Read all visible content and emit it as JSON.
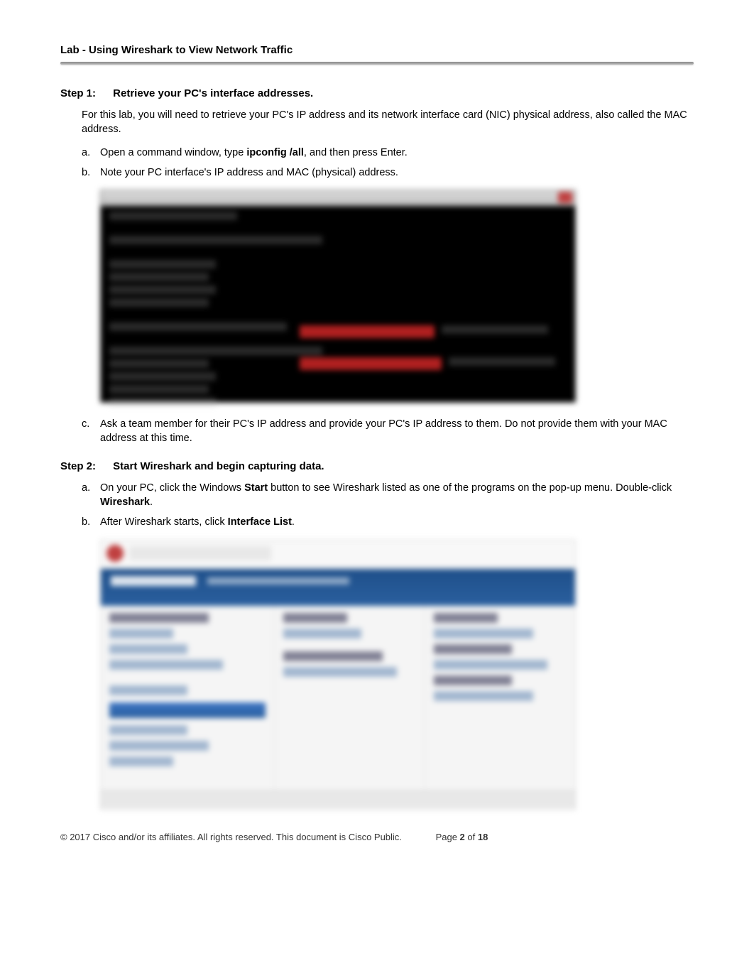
{
  "header": {
    "title": "Lab - Using Wireshark to View Network Traffic"
  },
  "step1": {
    "heading_label": "Step 1:",
    "heading_text": "Retrieve your PC's interface addresses.",
    "intro": "For this lab, you will need to retrieve your PC's IP address and its network interface card (NIC) physical address, also called the MAC address.",
    "a": {
      "letter": "a.",
      "pre": "Open a command window, type ",
      "cmd": "ipconfig /all",
      "post": ", and then press Enter."
    },
    "b": {
      "letter": "b.",
      "text": "Note your PC interface's IP address and MAC (physical) address."
    },
    "c": {
      "letter": "c.",
      "text": "Ask a team member for their PC's IP address and provide your PC's IP address to them. Do not provide them with your MAC address at this time."
    }
  },
  "step2": {
    "heading_label": "Step 2:",
    "heading_text": "Start Wireshark and begin capturing data.",
    "a": {
      "letter": "a.",
      "pre": "On your PC, click the Windows ",
      "bold1": "Start",
      "mid": " button to see Wireshark listed as one of the programs on the pop-up menu. Double-click ",
      "bold2": "Wireshark",
      "post": "."
    },
    "b": {
      "letter": "b.",
      "pre": "After Wireshark starts, click ",
      "bold": "Interface List",
      "post": "."
    }
  },
  "footer": {
    "copyright": "© 2017 Cisco and/or its affiliates. All rights reserved. This document is Cisco Public.",
    "page_pre": "Page ",
    "page_cur": "2",
    "page_mid": " of ",
    "page_total": "18"
  }
}
